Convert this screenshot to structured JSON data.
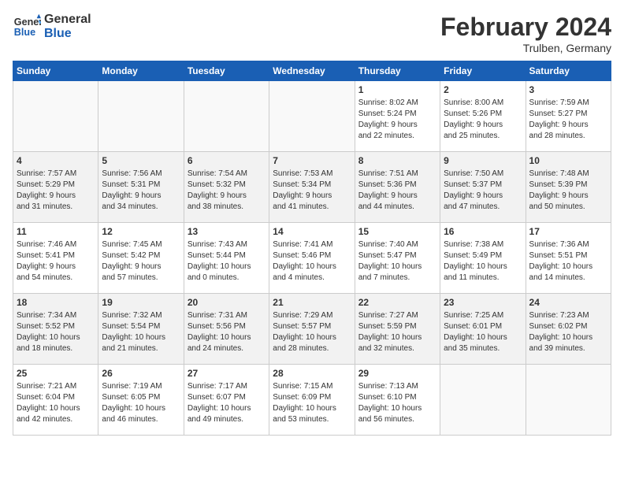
{
  "header": {
    "logo_general": "General",
    "logo_blue": "Blue",
    "month_title": "February 2024",
    "location": "Trulben, Germany"
  },
  "days_of_week": [
    "Sunday",
    "Monday",
    "Tuesday",
    "Wednesday",
    "Thursday",
    "Friday",
    "Saturday"
  ],
  "weeks": [
    {
      "shade": "white",
      "days": [
        {
          "number": "",
          "content": ""
        },
        {
          "number": "",
          "content": ""
        },
        {
          "number": "",
          "content": ""
        },
        {
          "number": "",
          "content": ""
        },
        {
          "number": "1",
          "content": "Sunrise: 8:02 AM\nSunset: 5:24 PM\nDaylight: 9 hours\nand 22 minutes."
        },
        {
          "number": "2",
          "content": "Sunrise: 8:00 AM\nSunset: 5:26 PM\nDaylight: 9 hours\nand 25 minutes."
        },
        {
          "number": "3",
          "content": "Sunrise: 7:59 AM\nSunset: 5:27 PM\nDaylight: 9 hours\nand 28 minutes."
        }
      ]
    },
    {
      "shade": "shade",
      "days": [
        {
          "number": "4",
          "content": "Sunrise: 7:57 AM\nSunset: 5:29 PM\nDaylight: 9 hours\nand 31 minutes."
        },
        {
          "number": "5",
          "content": "Sunrise: 7:56 AM\nSunset: 5:31 PM\nDaylight: 9 hours\nand 34 minutes."
        },
        {
          "number": "6",
          "content": "Sunrise: 7:54 AM\nSunset: 5:32 PM\nDaylight: 9 hours\nand 38 minutes."
        },
        {
          "number": "7",
          "content": "Sunrise: 7:53 AM\nSunset: 5:34 PM\nDaylight: 9 hours\nand 41 minutes."
        },
        {
          "number": "8",
          "content": "Sunrise: 7:51 AM\nSunset: 5:36 PM\nDaylight: 9 hours\nand 44 minutes."
        },
        {
          "number": "9",
          "content": "Sunrise: 7:50 AM\nSunset: 5:37 PM\nDaylight: 9 hours\nand 47 minutes."
        },
        {
          "number": "10",
          "content": "Sunrise: 7:48 AM\nSunset: 5:39 PM\nDaylight: 9 hours\nand 50 minutes."
        }
      ]
    },
    {
      "shade": "white",
      "days": [
        {
          "number": "11",
          "content": "Sunrise: 7:46 AM\nSunset: 5:41 PM\nDaylight: 9 hours\nand 54 minutes."
        },
        {
          "number": "12",
          "content": "Sunrise: 7:45 AM\nSunset: 5:42 PM\nDaylight: 9 hours\nand 57 minutes."
        },
        {
          "number": "13",
          "content": "Sunrise: 7:43 AM\nSunset: 5:44 PM\nDaylight: 10 hours\nand 0 minutes."
        },
        {
          "number": "14",
          "content": "Sunrise: 7:41 AM\nSunset: 5:46 PM\nDaylight: 10 hours\nand 4 minutes."
        },
        {
          "number": "15",
          "content": "Sunrise: 7:40 AM\nSunset: 5:47 PM\nDaylight: 10 hours\nand 7 minutes."
        },
        {
          "number": "16",
          "content": "Sunrise: 7:38 AM\nSunset: 5:49 PM\nDaylight: 10 hours\nand 11 minutes."
        },
        {
          "number": "17",
          "content": "Sunrise: 7:36 AM\nSunset: 5:51 PM\nDaylight: 10 hours\nand 14 minutes."
        }
      ]
    },
    {
      "shade": "shade",
      "days": [
        {
          "number": "18",
          "content": "Sunrise: 7:34 AM\nSunset: 5:52 PM\nDaylight: 10 hours\nand 18 minutes."
        },
        {
          "number": "19",
          "content": "Sunrise: 7:32 AM\nSunset: 5:54 PM\nDaylight: 10 hours\nand 21 minutes."
        },
        {
          "number": "20",
          "content": "Sunrise: 7:31 AM\nSunset: 5:56 PM\nDaylight: 10 hours\nand 24 minutes."
        },
        {
          "number": "21",
          "content": "Sunrise: 7:29 AM\nSunset: 5:57 PM\nDaylight: 10 hours\nand 28 minutes."
        },
        {
          "number": "22",
          "content": "Sunrise: 7:27 AM\nSunset: 5:59 PM\nDaylight: 10 hours\nand 32 minutes."
        },
        {
          "number": "23",
          "content": "Sunrise: 7:25 AM\nSunset: 6:01 PM\nDaylight: 10 hours\nand 35 minutes."
        },
        {
          "number": "24",
          "content": "Sunrise: 7:23 AM\nSunset: 6:02 PM\nDaylight: 10 hours\nand 39 minutes."
        }
      ]
    },
    {
      "shade": "white",
      "days": [
        {
          "number": "25",
          "content": "Sunrise: 7:21 AM\nSunset: 6:04 PM\nDaylight: 10 hours\nand 42 minutes."
        },
        {
          "number": "26",
          "content": "Sunrise: 7:19 AM\nSunset: 6:05 PM\nDaylight: 10 hours\nand 46 minutes."
        },
        {
          "number": "27",
          "content": "Sunrise: 7:17 AM\nSunset: 6:07 PM\nDaylight: 10 hours\nand 49 minutes."
        },
        {
          "number": "28",
          "content": "Sunrise: 7:15 AM\nSunset: 6:09 PM\nDaylight: 10 hours\nand 53 minutes."
        },
        {
          "number": "29",
          "content": "Sunrise: 7:13 AM\nSunset: 6:10 PM\nDaylight: 10 hours\nand 56 minutes."
        },
        {
          "number": "",
          "content": ""
        },
        {
          "number": "",
          "content": ""
        }
      ]
    }
  ]
}
